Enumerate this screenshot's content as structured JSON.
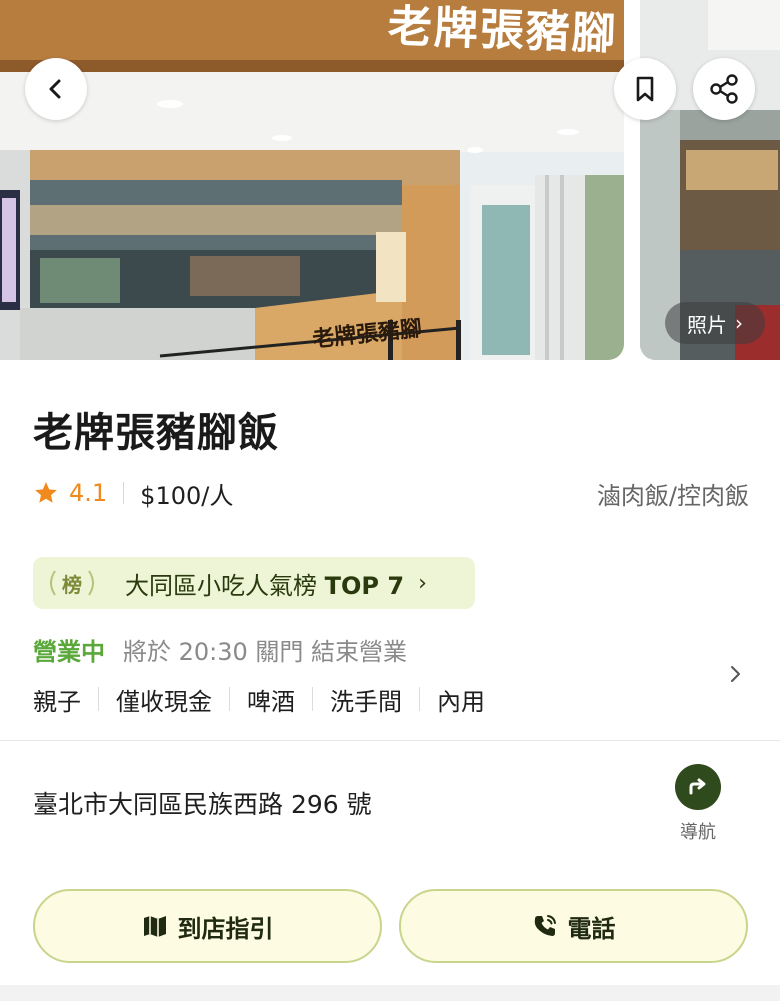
{
  "gallery": {
    "sign_text": "老牌張豬腳",
    "photos_link_label": "照片",
    "photos_chevron": "›"
  },
  "restaurant": {
    "name": "老牌張豬腳飯",
    "rating": "4.1",
    "price": "$100/人",
    "cuisine": "滷肉飯/控肉飯"
  },
  "ranking": {
    "badge": "榜",
    "text": "大同區小吃人氣榜",
    "top": "TOP 7",
    "chevron": "›"
  },
  "hours": {
    "status": "營業中",
    "detail": "將於 20:30 關門 結束營業"
  },
  "tags": [
    "親子",
    "僅收現金",
    "啤酒",
    "洗手間",
    "內用"
  ],
  "address": {
    "text": "臺北市大同區民族西路 296 號",
    "nav_label": "導航"
  },
  "actions": {
    "guide_label": "到店指引",
    "phone_label": "電話"
  },
  "icons": {
    "back": "chevron-left-icon",
    "bookmark": "bookmark-icon",
    "share": "share-icon",
    "star": "star-icon",
    "navigate": "navigate-icon",
    "map": "map-icon",
    "phone": "phone-icon"
  },
  "colors": {
    "rating": "#f08a1c",
    "open": "#5aa83a",
    "chip_bg": "#edf5d6",
    "button_bg": "#fdfbe2",
    "button_border": "#c9d48c",
    "nav_icon_bg": "#2f4a1c"
  }
}
